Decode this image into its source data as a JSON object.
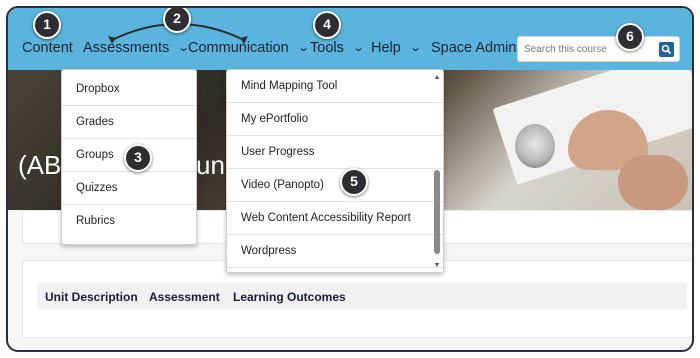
{
  "nav": {
    "items": [
      {
        "label": "Content",
        "dropdown": false
      },
      {
        "label": "Assessments",
        "dropdown": true
      },
      {
        "label": "Communication",
        "dropdown": true
      },
      {
        "label": "Tools",
        "dropdown": true
      },
      {
        "label": "Help",
        "dropdown": true
      },
      {
        "label": "Space Admin",
        "dropdown": false
      }
    ],
    "search_placeholder": "Search this course"
  },
  "banner": {
    "title_fragment_left": "(AB",
    "title_fragment_right": "und"
  },
  "assessments_menu": [
    "Dropbox",
    "Grades",
    "Groups",
    "Quizzes",
    "Rubrics"
  ],
  "tools_menu": [
    "Mind Mapping Tool",
    "My ePortfolio",
    "User Progress",
    "Video (Panopto)",
    "Web Content Accessibility Report",
    "Wordpress"
  ],
  "tabs": [
    "Unit Description",
    "Assessment",
    "Learning Outcomes"
  ],
  "callouts": [
    "1",
    "2",
    "3",
    "4",
    "5",
    "6"
  ],
  "icons": {
    "chevron": "chevron-down-icon",
    "search": "search-icon",
    "scroll_up": "scroll-up-icon",
    "scroll_down": "scroll-down-icon"
  },
  "colors": {
    "navbar": "#5ab4dd",
    "badge": "#2d2d33",
    "search_button": "#1f5fa6"
  }
}
